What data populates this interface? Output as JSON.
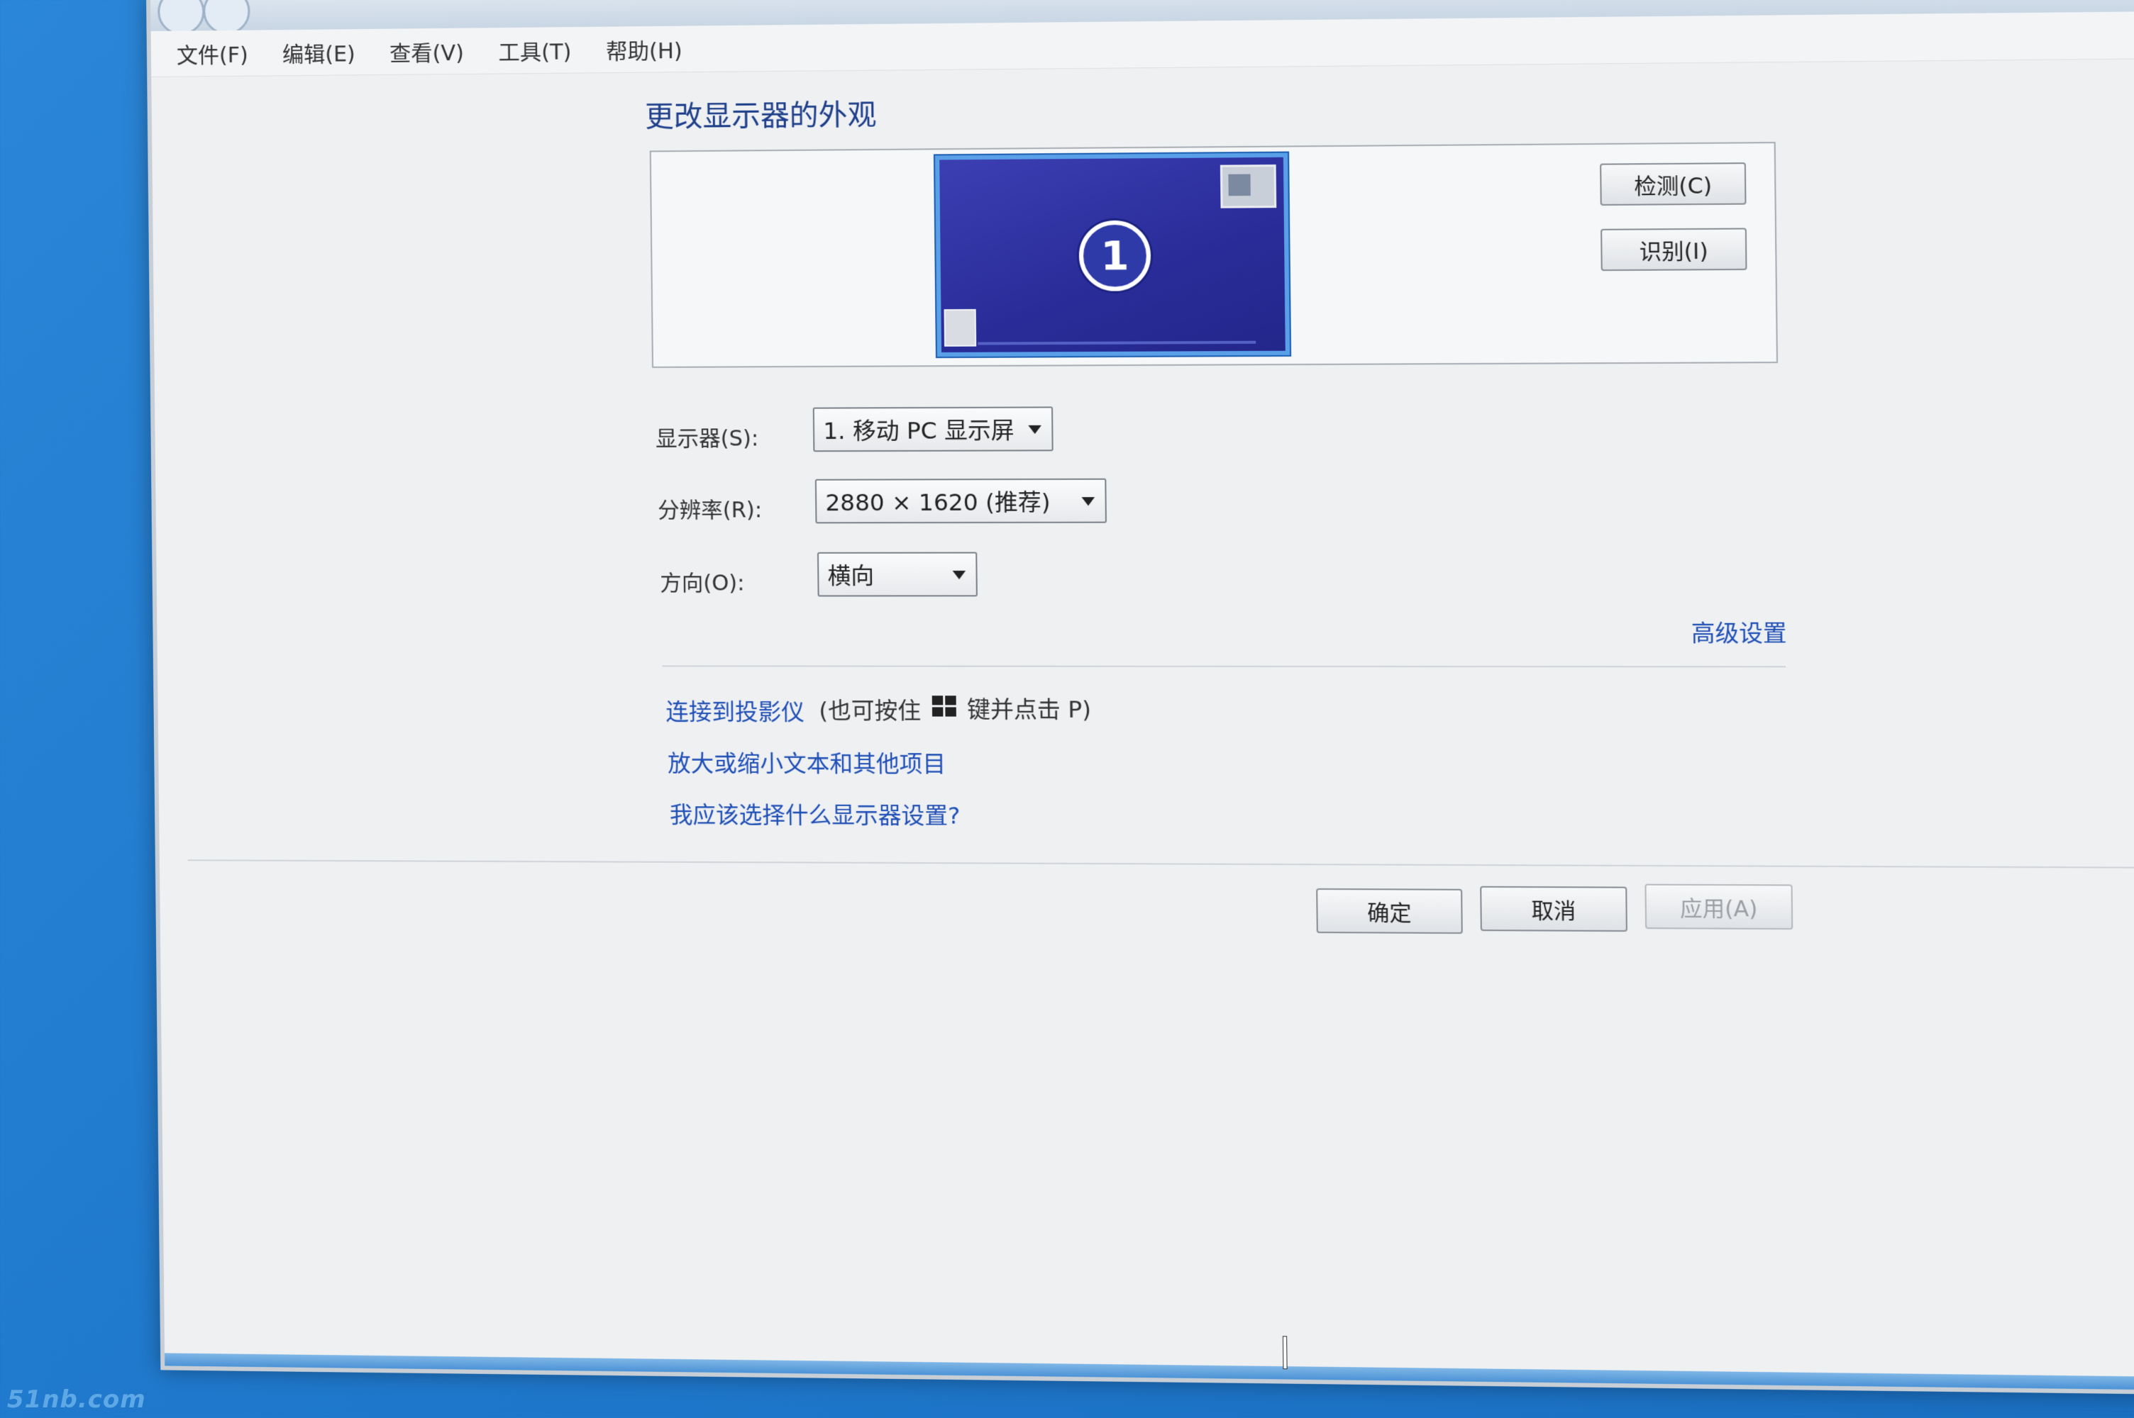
{
  "menubar": {
    "items": [
      "文件(F)",
      "编辑(E)",
      "查看(V)",
      "工具(T)",
      "帮助(H)"
    ]
  },
  "main": {
    "title": "更改显示器的外观",
    "preview": {
      "monitor_number": "1",
      "detect_label": "检测(C)",
      "identify_label": "识别(I)"
    },
    "display": {
      "label": "显示器(S):",
      "value": "1. 移动 PC 显示屏"
    },
    "resolution": {
      "label": "分辨率(R):",
      "value": "2880 × 1620 (推荐)"
    },
    "orientation": {
      "label": "方向(O):",
      "value": "横向"
    },
    "advanced_link": "高级设置",
    "projector_link": "连接到投影仪",
    "projector_hint_prefix": "(也可按住",
    "projector_hint_suffix": "键并点击 P)",
    "text_size_link": "放大或缩小文本和其他项目",
    "help_link": "我应该选择什么显示器设置?"
  },
  "footer": {
    "ok_label": "确定",
    "cancel_label": "取消",
    "apply_label": "应用(A)"
  },
  "watermark": "51nb.com",
  "icons": {
    "windows_key": "windows-logo-icon",
    "monitor": "monitor-icon"
  }
}
